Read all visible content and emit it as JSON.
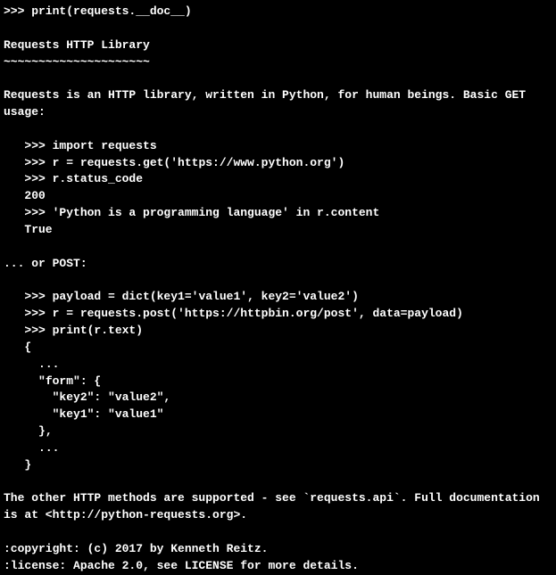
{
  "terminal": {
    "lines": [
      ">>> print(requests.__doc__)",
      "",
      "Requests HTTP Library",
      "~~~~~~~~~~~~~~~~~~~~~",
      "",
      "Requests is an HTTP library, written in Python, for human beings. Basic GET",
      "usage:",
      "",
      "   >>> import requests",
      "   >>> r = requests.get('https://www.python.org')",
      "   >>> r.status_code",
      "   200",
      "   >>> 'Python is a programming language' in r.content",
      "   True",
      "",
      "... or POST:",
      "",
      "   >>> payload = dict(key1='value1', key2='value2')",
      "   >>> r = requests.post('https://httpbin.org/post', data=payload)",
      "   >>> print(r.text)",
      "   {",
      "     ...",
      "     \"form\": {",
      "       \"key2\": \"value2\",",
      "       \"key1\": \"value1\"",
      "     },",
      "     ...",
      "   }",
      "",
      "The other HTTP methods are supported - see `requests.api`. Full documentation",
      "is at <http://python-requests.org>.",
      "",
      ":copyright: (c) 2017 by Kenneth Reitz.",
      ":license: Apache 2.0, see LICENSE for more details."
    ]
  }
}
